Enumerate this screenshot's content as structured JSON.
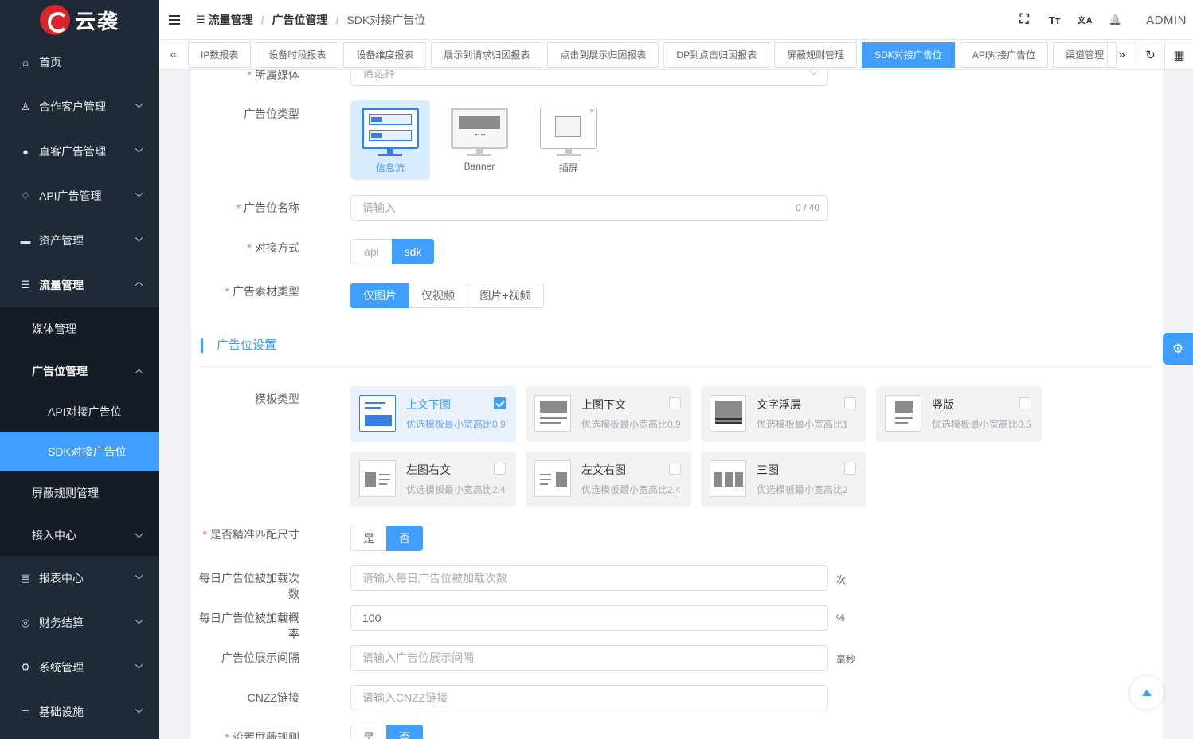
{
  "logo": {
    "text": "云袭"
  },
  "sidebar": {
    "items": [
      {
        "label": "首页",
        "icon": "home-icon"
      },
      {
        "label": "合作客户管理",
        "icon": "user-icon"
      },
      {
        "label": "直客广告管理",
        "icon": "person-icon"
      },
      {
        "label": "API广告管理",
        "icon": "bulb-icon"
      },
      {
        "label": "资产管理",
        "icon": "briefcase-icon"
      },
      {
        "label": "流量管理",
        "icon": "list-icon"
      },
      {
        "label": "报表中心",
        "icon": "document-icon"
      },
      {
        "label": "财务结算",
        "icon": "globe-icon"
      },
      {
        "label": "系统管理",
        "icon": "gear-icon"
      },
      {
        "label": "基础设施",
        "icon": "monitor-icon"
      }
    ],
    "traffic_sub": {
      "media": "媒体管理",
      "adslot": "广告位管理",
      "api_adslot": "API对接广告位",
      "sdk_adslot": "SDK对接广告位",
      "block_rules": "屏蔽规则管理",
      "access_center": "接入中心"
    }
  },
  "navbar": {
    "breadcrumb": [
      "流量管理",
      "广告位管理",
      "SDK对接广告位"
    ],
    "user": "ADMIN",
    "fullscreen_glyph": "⛶",
    "font_glyph": "Tт",
    "translate_glyph": "文A",
    "bell_glyph": "🔔"
  },
  "tags": [
    "IP数报表",
    "设备时段报表",
    "设备维度报表",
    "展示到请求归因报表",
    "点击到展示归因报表",
    "DP到点击归因报表",
    "屏蔽规则管理",
    "SDK对接广告位",
    "API对接广告位",
    "渠道管理"
  ],
  "tag_active_index": 7,
  "form": {
    "media": {
      "label": "所属媒体",
      "placeholder": "请选择"
    },
    "slot_type": {
      "label": "广告位类型",
      "options": [
        "信息流",
        "Banner",
        "插屏"
      ],
      "selected": "信息流"
    },
    "slot_name": {
      "label": "广告位名称",
      "placeholder": "请输入",
      "count": "0 / 40"
    },
    "connect": {
      "label": "对接方式",
      "options": [
        "api",
        "sdk"
      ],
      "selected": "sdk"
    },
    "material": {
      "label": "广告素材类型",
      "options": [
        "仅图片",
        "仅视频",
        "图片+视频"
      ],
      "selected": "仅图片"
    },
    "section_title": "广告位设置",
    "template": {
      "label": "模板类型",
      "items": [
        {
          "name": "上文下图",
          "desc": "优选模板最小宽高比0.9",
          "checked": true
        },
        {
          "name": "上图下文",
          "desc": "优选模板最小宽高比0.9",
          "checked": false
        },
        {
          "name": "文字浮层",
          "desc": "优选模板最小宽高比1",
          "checked": false
        },
        {
          "name": "竖版",
          "desc": "优选模板最小宽高比0.5",
          "checked": false
        },
        {
          "name": "左图右文",
          "desc": "优选模板最小宽高比2.4",
          "checked": false
        },
        {
          "name": "左文右图",
          "desc": "优选模板最小宽高比2.4",
          "checked": false
        },
        {
          "name": "三图",
          "desc": "优选模板最小宽高比2",
          "checked": false
        }
      ]
    },
    "exact_size": {
      "label": "是否精准匹配尺寸",
      "options": [
        "是",
        "否"
      ],
      "selected": "否"
    },
    "daily_loads": {
      "label": "每日广告位被加载次数",
      "placeholder": "请输入每日广告位被加载次数",
      "suffix": "次"
    },
    "daily_rate": {
      "label": "每日广告位被加载概率",
      "value": "100",
      "suffix": "%"
    },
    "interval": {
      "label": "广告位展示间隔",
      "placeholder": "请输入广告位展示间隔",
      "suffix": "毫秒"
    },
    "cnzz": {
      "label": "CNZZ链接",
      "placeholder": "请输入CNZZ链接"
    },
    "block_rule": {
      "label": "设置屏蔽规则",
      "options": [
        "是",
        "否"
      ],
      "selected": "否"
    }
  },
  "colors": {
    "primary": "#409eff",
    "sidebar": "#1e2a36",
    "required": "#f56c6c"
  }
}
